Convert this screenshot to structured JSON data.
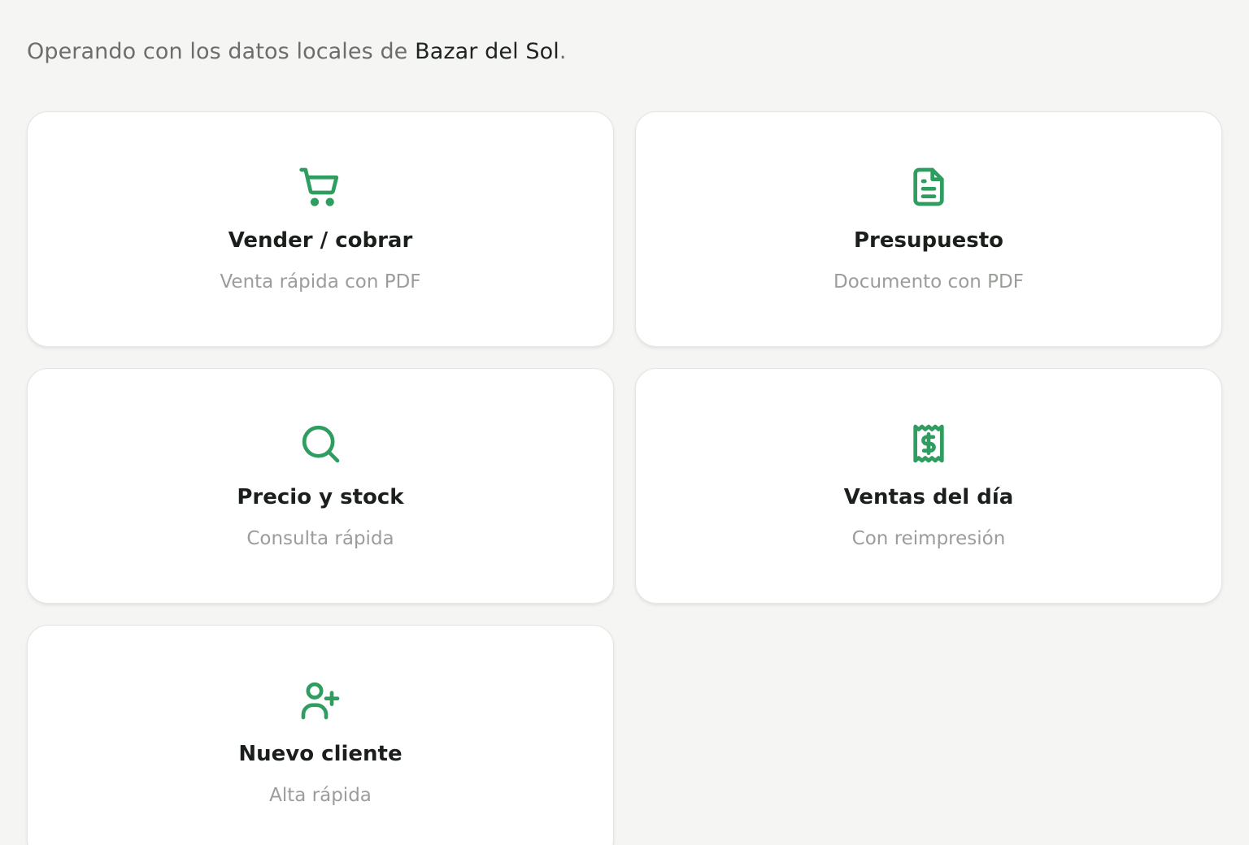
{
  "header": {
    "intro_prefix": "Operando con los datos locales de ",
    "store_name": "Bazar del Sol",
    "intro_suffix": "."
  },
  "accent_color": "#2e9d5f",
  "cards": [
    {
      "icon": "shopping-cart-icon",
      "title": "Vender / cobrar",
      "subtitle": "Venta rápida con PDF"
    },
    {
      "icon": "document-icon",
      "title": "Presupuesto",
      "subtitle": "Documento con PDF"
    },
    {
      "icon": "search-icon",
      "title": "Precio y stock",
      "subtitle": "Consulta rápida"
    },
    {
      "icon": "receipt-dollar-icon",
      "title": "Ventas del día",
      "subtitle": "Con reimpresión"
    },
    {
      "icon": "user-plus-icon",
      "title": "Nuevo cliente",
      "subtitle": "Alta rápida"
    }
  ]
}
